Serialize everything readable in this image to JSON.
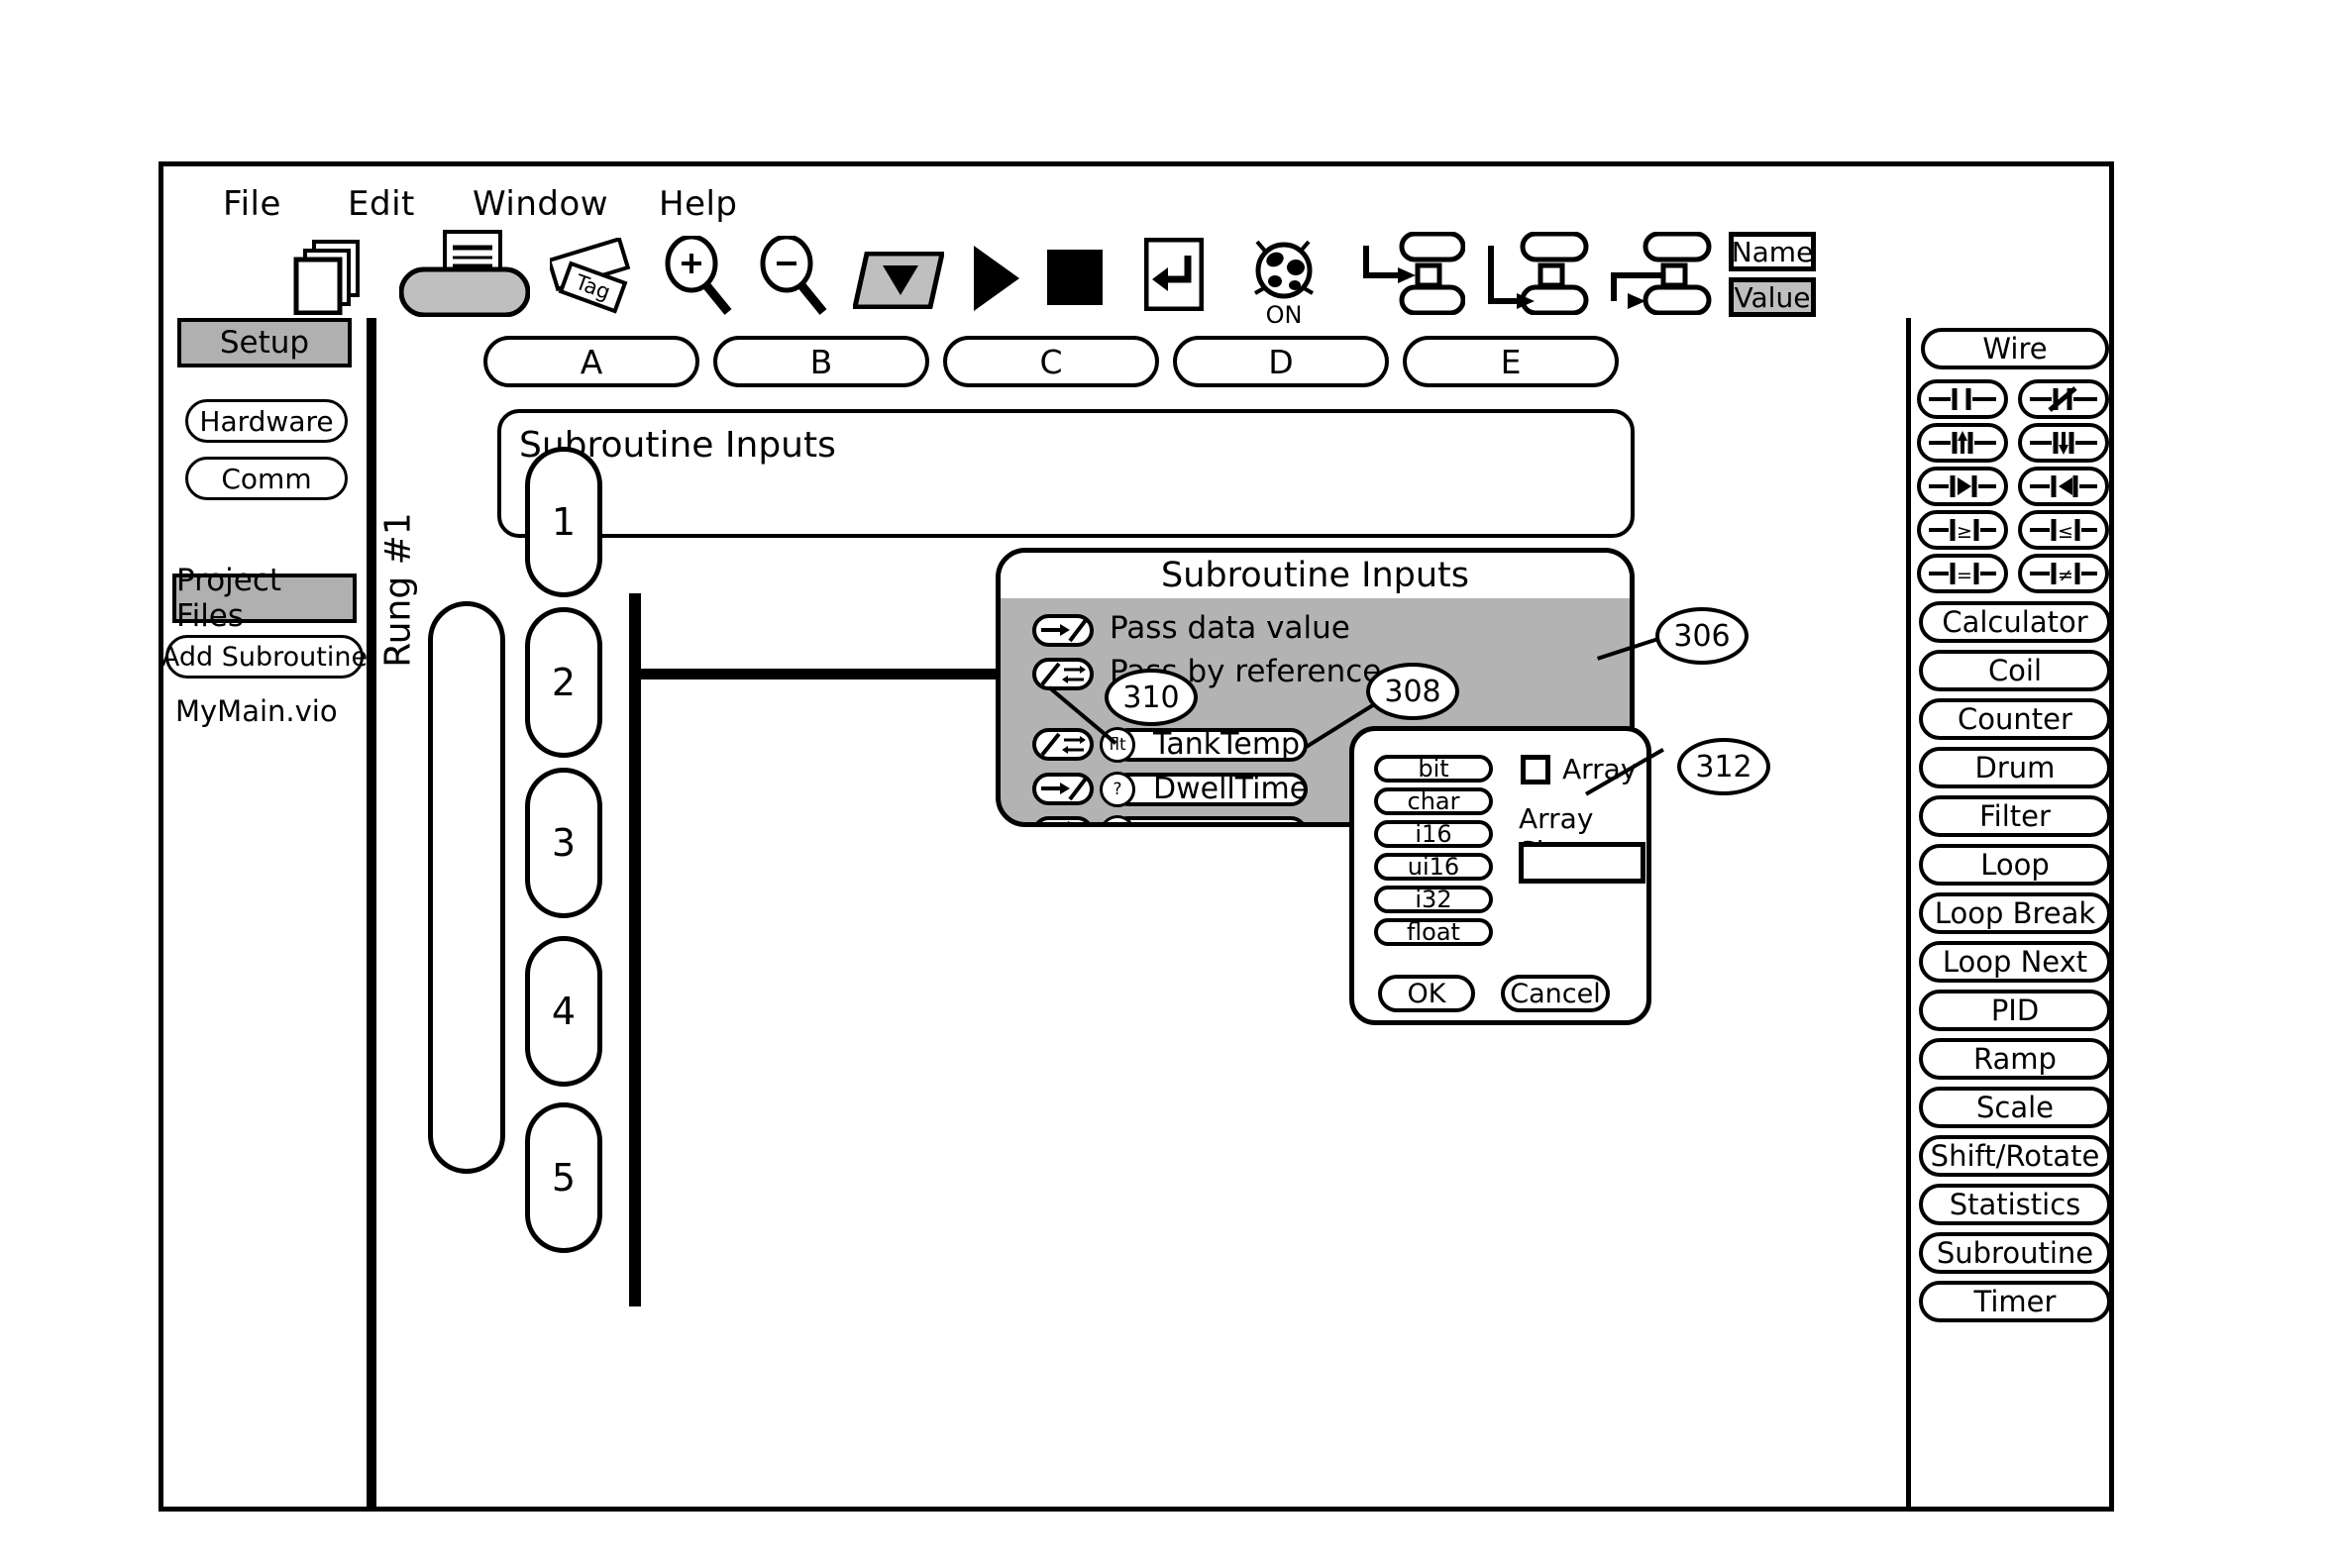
{
  "menu": {
    "items": [
      {
        "label": "File"
      },
      {
        "label": "Edit"
      },
      {
        "label": "Window"
      },
      {
        "label": "Help"
      }
    ]
  },
  "toolbar": {
    "icons": [
      {
        "name": "new-file-icon",
        "tooltip": "File"
      },
      {
        "name": "edit-print-icon",
        "tooltip": "Edit"
      },
      {
        "name": "tag-icon",
        "tooltip": "Tag"
      },
      {
        "name": "zoom-in-icon",
        "tooltip": "Zoom In"
      },
      {
        "name": "zoom-out-icon",
        "tooltip": "Zoom Out"
      },
      {
        "name": "dropdown-icon",
        "tooltip": "Select"
      },
      {
        "name": "run-icon",
        "tooltip": "Run"
      },
      {
        "name": "stop-icon",
        "tooltip": "Stop"
      },
      {
        "name": "return-icon",
        "tooltip": "Return"
      },
      {
        "name": "debug-bug-icon",
        "tooltip": "Debug ON"
      },
      {
        "name": "flow-branch-1-icon",
        "tooltip": "Flow Branch"
      },
      {
        "name": "flow-branch-2-icon",
        "tooltip": "Flow Branch"
      },
      {
        "name": "flow-branch-3-icon",
        "tooltip": "Flow Branch"
      }
    ],
    "debug_state_label": "ON",
    "name_button_label": "Name",
    "value_button_label": "Value"
  },
  "sidebar": {
    "setup_header": "Setup",
    "setup_items": [
      {
        "label": "Hardware"
      },
      {
        "label": "Comm"
      }
    ],
    "project_header": "Project Files",
    "add_subroutine_label": "Add Subroutine",
    "project_files": [
      {
        "label": "MyMain.vio"
      }
    ]
  },
  "canvas": {
    "column_tabs": [
      "A",
      "B",
      "C",
      "D",
      "E"
    ],
    "subroutine_panel_label": "Subroutine Inputs",
    "rung_group_label": "Rung #1",
    "rung_numbers": [
      "1",
      "2",
      "3",
      "4",
      "5"
    ]
  },
  "palette": {
    "wire_label": "Wire",
    "contacts": [
      {
        "name": "contact-no-icon",
        "symbol": "normally-open"
      },
      {
        "name": "contact-nc-icon",
        "symbol": "normally-closed"
      },
      {
        "name": "contact-rising-edge-icon",
        "symbol": "rising-edge"
      },
      {
        "name": "contact-falling-edge-icon",
        "symbol": "falling-edge"
      },
      {
        "name": "compare-greater-icon",
        "symbol": ">"
      },
      {
        "name": "compare-less-icon",
        "symbol": "<"
      },
      {
        "name": "compare-greater-equal-icon",
        "symbol": "≥"
      },
      {
        "name": "compare-less-equal-icon",
        "symbol": "≤"
      },
      {
        "name": "compare-equal-icon",
        "symbol": "="
      },
      {
        "name": "compare-not-equal-icon",
        "symbol": "≠"
      }
    ],
    "blocks": [
      {
        "label": "Calculator"
      },
      {
        "label": "Coil"
      },
      {
        "label": "Counter"
      },
      {
        "label": "Drum"
      },
      {
        "label": "Filter"
      },
      {
        "label": "Loop"
      },
      {
        "label": "Loop Break"
      },
      {
        "label": "Loop Next"
      },
      {
        "label": "PID"
      },
      {
        "label": "Ramp"
      },
      {
        "label": "Scale"
      },
      {
        "label": "Shift/Rotate"
      },
      {
        "label": "Statistics"
      },
      {
        "label": "Subroutine"
      },
      {
        "label": "Timer"
      }
    ]
  },
  "dialog_inputs": {
    "title": "Subroutine Inputs",
    "legend": [
      {
        "label": "Pass data value",
        "mode": "value"
      },
      {
        "label": "Pass by reference",
        "mode": "reference"
      }
    ],
    "rows": [
      {
        "mode": "reference",
        "type": "flt",
        "value": "TankTemp"
      },
      {
        "mode": "value",
        "type": "?",
        "value": "DwellTime"
      },
      {
        "mode": "both",
        "type": "?",
        "value": ""
      }
    ]
  },
  "dialog_type": {
    "options": [
      "bit",
      "char",
      "i16",
      "ui16",
      "i32",
      "float"
    ],
    "array_checkbox_label": "Array",
    "array_checked": false,
    "array_size_label": "Array Size",
    "array_size_value": "",
    "ok_label": "OK",
    "cancel_label": "Cancel"
  },
  "callouts": [
    {
      "id": "306",
      "label": "306"
    },
    {
      "id": "308",
      "label": "308"
    },
    {
      "id": "310",
      "label": "310"
    },
    {
      "id": "312",
      "label": "312"
    }
  ]
}
